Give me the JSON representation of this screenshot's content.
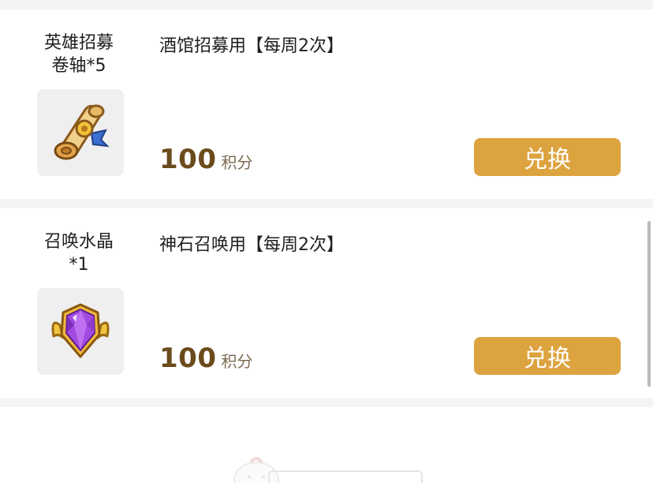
{
  "items": [
    {
      "name_line1": "英雄招募",
      "name_line2": "卷轴*5",
      "description": "酒馆招募用【每周2次】",
      "price": "100",
      "unit": "积分",
      "button_label": "兑换",
      "icon": "scroll-icon"
    },
    {
      "name_line1": "召唤水晶",
      "name_line2": "*1",
      "description": "神石召唤用【每周2次】",
      "price": "100",
      "unit": "积分",
      "button_label": "兑换",
      "icon": "crystal-icon"
    }
  ],
  "colors": {
    "button": "#dda33f",
    "price": "#6b4b1c",
    "background": "#f4f4f4"
  }
}
